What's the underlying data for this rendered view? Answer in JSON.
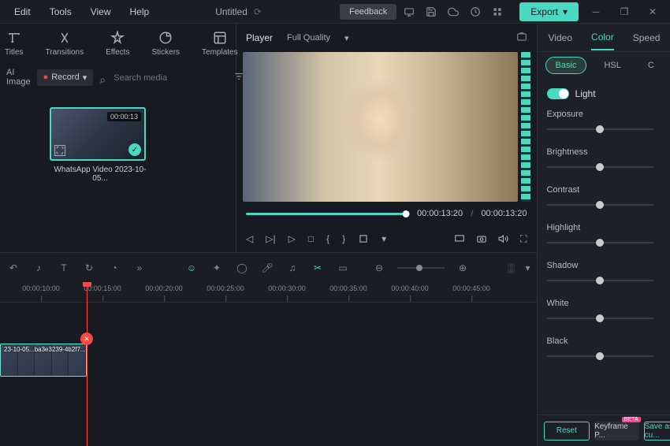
{
  "menubar": {
    "items": [
      "Edit",
      "Tools",
      "View",
      "Help"
    ],
    "title": "Untitled",
    "feedback": "Feedback",
    "export": "Export"
  },
  "library": {
    "tabs": [
      {
        "label": "Titles"
      },
      {
        "label": "Transitions"
      },
      {
        "label": "Effects"
      },
      {
        "label": "Stickers"
      },
      {
        "label": "Templates"
      }
    ],
    "ai_image": "AI Image",
    "record": "Record",
    "search_placeholder": "Search media",
    "clip": {
      "duration": "00:00:13",
      "name": "WhatsApp Video 2023-10-05..."
    }
  },
  "player": {
    "title": "Player",
    "quality": "Full Quality",
    "current": "00:00:13:20",
    "total": "00:00:13:20"
  },
  "timeline": {
    "marks": [
      "00:00:10:00",
      "00:00:15:00",
      "00:00:20:00",
      "00:00:25:00",
      "00:00:30:00",
      "00:00:35:00",
      "00:00:40:00",
      "00:00:45:00"
    ],
    "clip_label": "23-10-05...ba3e3239-4b2f7..."
  },
  "panel": {
    "tabs": [
      "Video",
      "Color",
      "Speed"
    ],
    "subtabs": [
      "Basic",
      "HSL",
      "C"
    ],
    "section": "Light",
    "sliders": [
      {
        "label": "Exposure",
        "value": "0.00"
      },
      {
        "label": "Brightness",
        "value": "0.00"
      },
      {
        "label": "Contrast",
        "value": "0.00"
      },
      {
        "label": "Highlight",
        "value": "0.00"
      },
      {
        "label": "Shadow",
        "value": "0.00"
      },
      {
        "label": "White",
        "value": "0.00"
      },
      {
        "label": "Black",
        "value": "0.00"
      }
    ],
    "reset": "Reset",
    "keyframe": "Keyframe P...",
    "save": "Save as cu...",
    "beta": "BETA"
  }
}
